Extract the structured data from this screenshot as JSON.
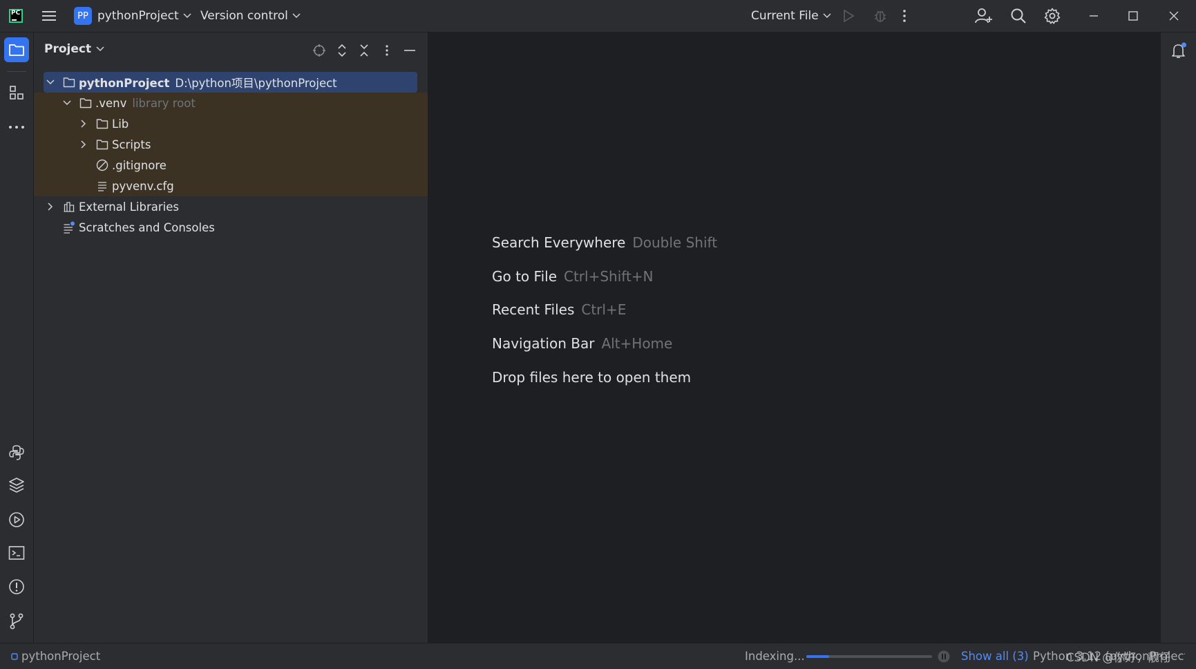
{
  "titlebar": {
    "app_logo": "pycharm-logo",
    "project_badge": "PP",
    "project_name": "pythonProject",
    "vcs_label": "Version control",
    "run_config": "Current File"
  },
  "project_panel": {
    "title": "Project",
    "tree": [
      {
        "label": "pythonProject",
        "path": "D:\\python项目\\pythonProject"
      },
      {
        "label": ".venv",
        "hint": "library root"
      },
      {
        "label": "Lib"
      },
      {
        "label": "Scripts"
      },
      {
        "label": ".gitignore"
      },
      {
        "label": "pyvenv.cfg"
      },
      {
        "label": "External Libraries"
      },
      {
        "label": "Scratches and Consoles"
      }
    ]
  },
  "editor": {
    "hints": [
      {
        "action": "Search Everywhere",
        "shortcut": "Double Shift"
      },
      {
        "action": "Go to File",
        "shortcut": "Ctrl+Shift+N"
      },
      {
        "action": "Recent Files",
        "shortcut": "Ctrl+E"
      },
      {
        "action": "Navigation Bar",
        "shortcut": "Alt+Home"
      },
      {
        "action": "Drop files here to open them",
        "shortcut": ""
      }
    ]
  },
  "statusbar": {
    "project": "pythonProject",
    "indexing": "Indexing...",
    "indexing_progress": 0.18,
    "show_all": "Show all (3)",
    "interpreter": "Python 3.12 (pythonProject)",
    "watermark": "CSDN @你好，靓仔"
  },
  "colors": {
    "accent": "#3574f0",
    "selection": "#2e436e",
    "venv_highlight": "#3c3224",
    "panel_bg": "#2b2d30",
    "editor_bg": "#1e1f22"
  }
}
